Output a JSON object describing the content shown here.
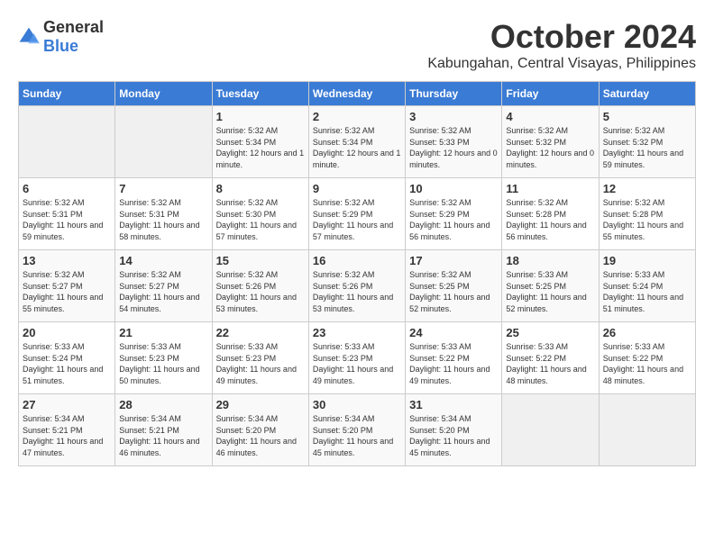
{
  "logo": {
    "general": "General",
    "blue": "Blue"
  },
  "title": {
    "month": "October 2024",
    "location": "Kabungahan, Central Visayas, Philippines"
  },
  "headers": [
    "Sunday",
    "Monday",
    "Tuesday",
    "Wednesday",
    "Thursday",
    "Friday",
    "Saturday"
  ],
  "weeks": [
    [
      {
        "day": "",
        "sunrise": "",
        "sunset": "",
        "daylight": ""
      },
      {
        "day": "",
        "sunrise": "",
        "sunset": "",
        "daylight": ""
      },
      {
        "day": "1",
        "sunrise": "Sunrise: 5:32 AM",
        "sunset": "Sunset: 5:34 PM",
        "daylight": "Daylight: 12 hours and 1 minute."
      },
      {
        "day": "2",
        "sunrise": "Sunrise: 5:32 AM",
        "sunset": "Sunset: 5:34 PM",
        "daylight": "Daylight: 12 hours and 1 minute."
      },
      {
        "day": "3",
        "sunrise": "Sunrise: 5:32 AM",
        "sunset": "Sunset: 5:33 PM",
        "daylight": "Daylight: 12 hours and 0 minutes."
      },
      {
        "day": "4",
        "sunrise": "Sunrise: 5:32 AM",
        "sunset": "Sunset: 5:32 PM",
        "daylight": "Daylight: 12 hours and 0 minutes."
      },
      {
        "day": "5",
        "sunrise": "Sunrise: 5:32 AM",
        "sunset": "Sunset: 5:32 PM",
        "daylight": "Daylight: 11 hours and 59 minutes."
      }
    ],
    [
      {
        "day": "6",
        "sunrise": "Sunrise: 5:32 AM",
        "sunset": "Sunset: 5:31 PM",
        "daylight": "Daylight: 11 hours and 59 minutes."
      },
      {
        "day": "7",
        "sunrise": "Sunrise: 5:32 AM",
        "sunset": "Sunset: 5:31 PM",
        "daylight": "Daylight: 11 hours and 58 minutes."
      },
      {
        "day": "8",
        "sunrise": "Sunrise: 5:32 AM",
        "sunset": "Sunset: 5:30 PM",
        "daylight": "Daylight: 11 hours and 57 minutes."
      },
      {
        "day": "9",
        "sunrise": "Sunrise: 5:32 AM",
        "sunset": "Sunset: 5:29 PM",
        "daylight": "Daylight: 11 hours and 57 minutes."
      },
      {
        "day": "10",
        "sunrise": "Sunrise: 5:32 AM",
        "sunset": "Sunset: 5:29 PM",
        "daylight": "Daylight: 11 hours and 56 minutes."
      },
      {
        "day": "11",
        "sunrise": "Sunrise: 5:32 AM",
        "sunset": "Sunset: 5:28 PM",
        "daylight": "Daylight: 11 hours and 56 minutes."
      },
      {
        "day": "12",
        "sunrise": "Sunrise: 5:32 AM",
        "sunset": "Sunset: 5:28 PM",
        "daylight": "Daylight: 11 hours and 55 minutes."
      }
    ],
    [
      {
        "day": "13",
        "sunrise": "Sunrise: 5:32 AM",
        "sunset": "Sunset: 5:27 PM",
        "daylight": "Daylight: 11 hours and 55 minutes."
      },
      {
        "day": "14",
        "sunrise": "Sunrise: 5:32 AM",
        "sunset": "Sunset: 5:27 PM",
        "daylight": "Daylight: 11 hours and 54 minutes."
      },
      {
        "day": "15",
        "sunrise": "Sunrise: 5:32 AM",
        "sunset": "Sunset: 5:26 PM",
        "daylight": "Daylight: 11 hours and 53 minutes."
      },
      {
        "day": "16",
        "sunrise": "Sunrise: 5:32 AM",
        "sunset": "Sunset: 5:26 PM",
        "daylight": "Daylight: 11 hours and 53 minutes."
      },
      {
        "day": "17",
        "sunrise": "Sunrise: 5:32 AM",
        "sunset": "Sunset: 5:25 PM",
        "daylight": "Daylight: 11 hours and 52 minutes."
      },
      {
        "day": "18",
        "sunrise": "Sunrise: 5:33 AM",
        "sunset": "Sunset: 5:25 PM",
        "daylight": "Daylight: 11 hours and 52 minutes."
      },
      {
        "day": "19",
        "sunrise": "Sunrise: 5:33 AM",
        "sunset": "Sunset: 5:24 PM",
        "daylight": "Daylight: 11 hours and 51 minutes."
      }
    ],
    [
      {
        "day": "20",
        "sunrise": "Sunrise: 5:33 AM",
        "sunset": "Sunset: 5:24 PM",
        "daylight": "Daylight: 11 hours and 51 minutes."
      },
      {
        "day": "21",
        "sunrise": "Sunrise: 5:33 AM",
        "sunset": "Sunset: 5:23 PM",
        "daylight": "Daylight: 11 hours and 50 minutes."
      },
      {
        "day": "22",
        "sunrise": "Sunrise: 5:33 AM",
        "sunset": "Sunset: 5:23 PM",
        "daylight": "Daylight: 11 hours and 49 minutes."
      },
      {
        "day": "23",
        "sunrise": "Sunrise: 5:33 AM",
        "sunset": "Sunset: 5:23 PM",
        "daylight": "Daylight: 11 hours and 49 minutes."
      },
      {
        "day": "24",
        "sunrise": "Sunrise: 5:33 AM",
        "sunset": "Sunset: 5:22 PM",
        "daylight": "Daylight: 11 hours and 49 minutes."
      },
      {
        "day": "25",
        "sunrise": "Sunrise: 5:33 AM",
        "sunset": "Sunset: 5:22 PM",
        "daylight": "Daylight: 11 hours and 48 minutes."
      },
      {
        "day": "26",
        "sunrise": "Sunrise: 5:33 AM",
        "sunset": "Sunset: 5:22 PM",
        "daylight": "Daylight: 11 hours and 48 minutes."
      }
    ],
    [
      {
        "day": "27",
        "sunrise": "Sunrise: 5:34 AM",
        "sunset": "Sunset: 5:21 PM",
        "daylight": "Daylight: 11 hours and 47 minutes."
      },
      {
        "day": "28",
        "sunrise": "Sunrise: 5:34 AM",
        "sunset": "Sunset: 5:21 PM",
        "daylight": "Daylight: 11 hours and 46 minutes."
      },
      {
        "day": "29",
        "sunrise": "Sunrise: 5:34 AM",
        "sunset": "Sunset: 5:20 PM",
        "daylight": "Daylight: 11 hours and 46 minutes."
      },
      {
        "day": "30",
        "sunrise": "Sunrise: 5:34 AM",
        "sunset": "Sunset: 5:20 PM",
        "daylight": "Daylight: 11 hours and 45 minutes."
      },
      {
        "day": "31",
        "sunrise": "Sunrise: 5:34 AM",
        "sunset": "Sunset: 5:20 PM",
        "daylight": "Daylight: 11 hours and 45 minutes."
      },
      {
        "day": "",
        "sunrise": "",
        "sunset": "",
        "daylight": ""
      },
      {
        "day": "",
        "sunrise": "",
        "sunset": "",
        "daylight": ""
      }
    ]
  ]
}
